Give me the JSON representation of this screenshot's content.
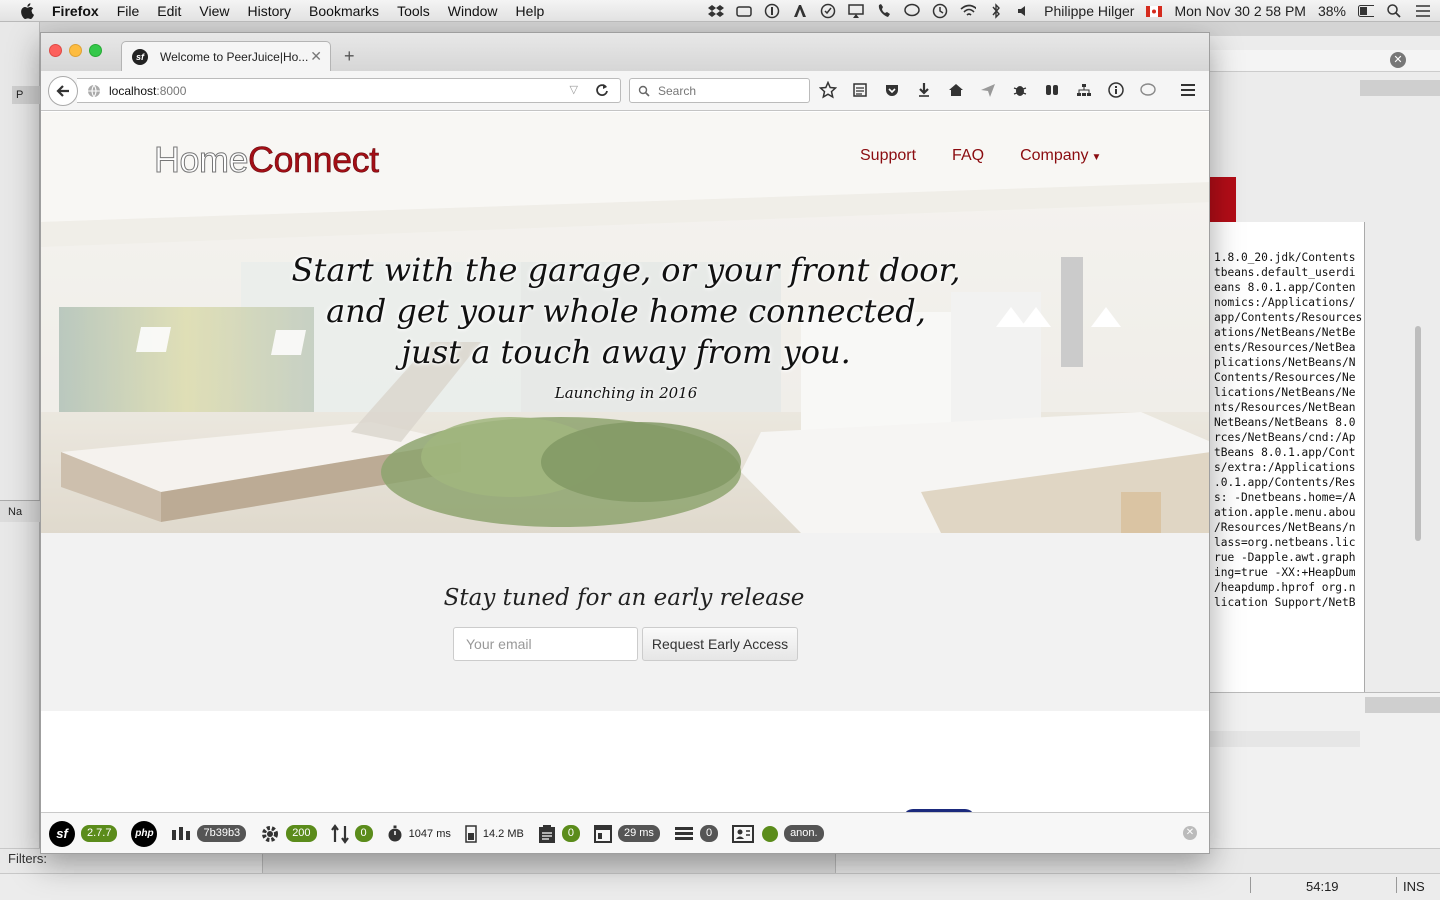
{
  "menubar": {
    "app": "Firefox",
    "items": [
      "File",
      "Edit",
      "View",
      "History",
      "Bookmarks",
      "Tools",
      "Window",
      "Help"
    ],
    "user": "Philippe Hilger",
    "datetime": "Mon Nov 30  2 58 PM",
    "battery": "38%"
  },
  "browser": {
    "tab_title": "Welcome to PeerJuice|Ho...",
    "url_host": "localhost",
    "url_port": ":8000",
    "search_placeholder": "Search"
  },
  "site": {
    "logo_part1": "Home",
    "logo_part2": "Connect",
    "nav": [
      "Support",
      "FAQ",
      "Company"
    ],
    "tagline_lines": [
      "Start with the garage, or your front door,",
      "and get your whole home connected,",
      "just a touch away from you."
    ],
    "launch": "Launching in 2016",
    "signup_title": "Stay tuned for an early release",
    "email_placeholder": "Your email",
    "request_button": "Request Early Access"
  },
  "symfony_toolbar": {
    "version": "2.7.7",
    "token": "7b39b3",
    "status": "200",
    "routes": "0",
    "time": "1047 ms",
    "memory": "14.2 MB",
    "logs": "0",
    "twig_time": "29 ms",
    "db_queries": "0",
    "user": "anon."
  },
  "background": {
    "left_tab": "P",
    "left_panel": "Na",
    "filters": "Filters:",
    "cursor_pos": "54:19",
    "mode": "INS",
    "console_lines": [
      "1.8.0_20.jdk/Contents",
      "tbeans.default_userdi",
      "eans 8.0.1.app/Conten",
      "nomics:/Applications/",
      "app/Contents/Resources",
      "ations/NetBeans/NetBe",
      "ents/Resources/NetBea",
      "plications/NetBeans/N",
      "Contents/Resources/Ne",
      "lications/NetBeans/Ne",
      "nts/Resources/NetBean",
      "NetBeans/NetBeans 8.0",
      "rces/NetBeans/cnd:/Ap",
      "tBeans 8.0.1.app/Cont",
      "s/extra:/Applications",
      ".0.1.app/Contents/Res",
      "s: -Dnetbeans.home=/A",
      "ation.apple.menu.abou",
      "/Resources/NetBeans/n",
      "lass=org.netbeans.lic",
      "rue -Dapple.awt.graph",
      "ing=true -XX:+HeapDum",
      "/heapdump.hprof org.n",
      "lication Support/NetB"
    ]
  }
}
